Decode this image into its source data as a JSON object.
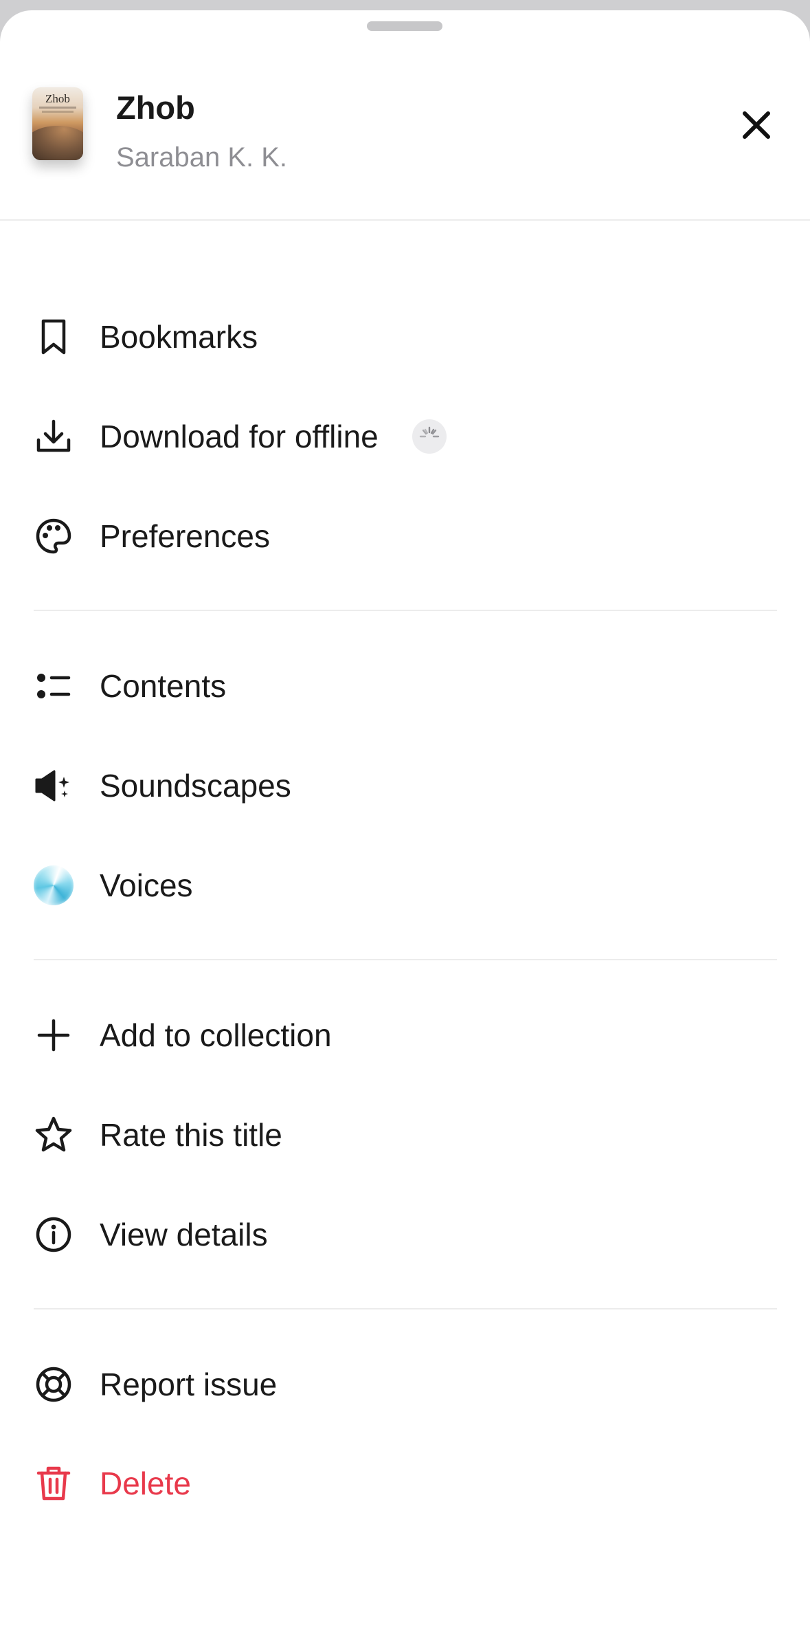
{
  "header": {
    "cover_title": "Zhob",
    "title": "Zhob",
    "author": "Saraban K. K."
  },
  "groups": [
    {
      "items": [
        {
          "label": "Bookmarks",
          "icon": "bookmark-icon"
        },
        {
          "label": "Download for offline",
          "icon": "download-icon",
          "status_icon": "loading-spinner-icon"
        },
        {
          "label": "Preferences",
          "icon": "palette-icon"
        }
      ]
    },
    {
      "items": [
        {
          "label": "Contents",
          "icon": "list-icon"
        },
        {
          "label": "Soundscapes",
          "icon": "speaker-sparkle-icon"
        },
        {
          "label": "Voices",
          "icon": "voice-orb-icon"
        }
      ]
    },
    {
      "items": [
        {
          "label": "Add to collection",
          "icon": "plus-icon"
        },
        {
          "label": "Rate this title",
          "icon": "star-icon"
        },
        {
          "label": "View details",
          "icon": "info-icon"
        }
      ]
    },
    {
      "items": [
        {
          "label": "Report issue",
          "icon": "lifebuoy-icon"
        },
        {
          "label": "Delete",
          "icon": "trash-icon",
          "color": "#e8394b"
        }
      ]
    }
  ],
  "colors": {
    "danger": "#e8394b",
    "secondary_text": "#8e8e93",
    "sheet_background": "#ffffff",
    "backdrop": "#cfcfd1"
  }
}
